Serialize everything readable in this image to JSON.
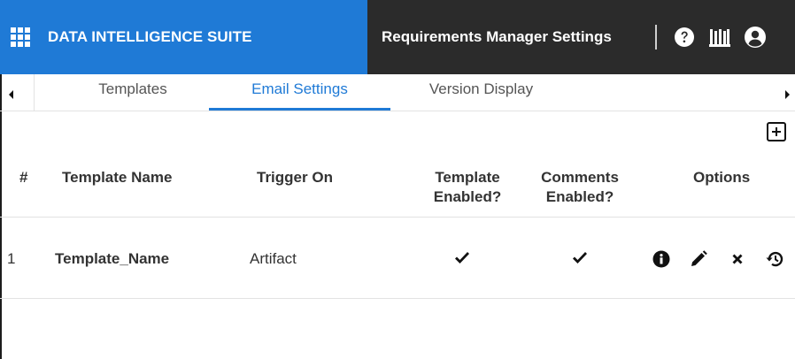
{
  "header": {
    "brand_title": "DATA INTELLIGENCE SUITE",
    "app_title": "Requirements Manager Settings",
    "icons": [
      "apps-grid-icon",
      "help-icon",
      "library-icon",
      "user-account-icon"
    ],
    "brand_color": "#1f7ad6",
    "bar_color": "#2b2b2b"
  },
  "tabs": [
    {
      "label": "Templates",
      "active": false
    },
    {
      "label": "Email Settings",
      "active": true
    },
    {
      "label": "Version Display",
      "active": false
    }
  ],
  "toolbar": {
    "add_icon": "add-square-icon"
  },
  "table": {
    "columns": {
      "index": "#",
      "name": "Template Name",
      "trigger": "Trigger On",
      "template_enabled_1": "Template",
      "template_enabled_2": "Enabled?",
      "comments_enabled_1": "Comments",
      "comments_enabled_2": "Enabled?",
      "options": "Options"
    },
    "rows": [
      {
        "index": "1",
        "name": "Template_Name",
        "trigger": "Artifact",
        "template_enabled": true,
        "comments_enabled": true,
        "option_icons": [
          "info-icon",
          "edit-pencil-icon",
          "delete-x-icon",
          "history-restore-icon"
        ]
      }
    ]
  }
}
